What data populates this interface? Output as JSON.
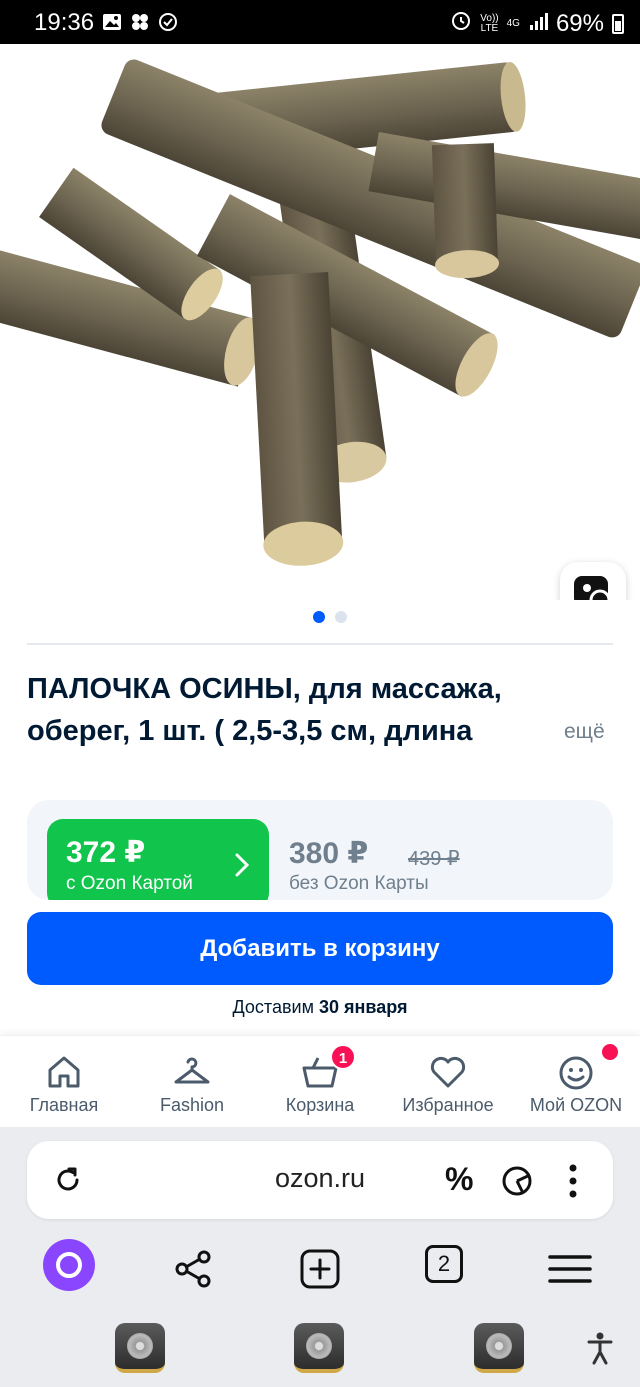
{
  "status_bar": {
    "time": "19:36",
    "network_top": "Vo))",
    "network_bottom": "LTE",
    "signal_type": "4G",
    "battery": "69%"
  },
  "product": {
    "image_alt": "Aspen wood sticks",
    "carousel": {
      "total": 2,
      "active": 1
    },
    "title_line1": "ПАЛОЧКА ОСИНЫ, для массажа,",
    "title_line2": "оберег, 1 шт. ( 2,5-3,5 см, длина",
    "more_label": "ещё"
  },
  "pricing": {
    "card_price": "372 ₽",
    "card_label": "с Ozon Картой",
    "regular_price": "380 ₽",
    "old_price": "439 ₽",
    "regular_label": "без Ozon Карты"
  },
  "actions": {
    "add_to_cart": "Добавить в корзину",
    "delivery_prefix": "Доставим",
    "delivery_date": "30 января"
  },
  "bottom_nav": {
    "items": [
      {
        "label": "Главная",
        "icon": "home-icon"
      },
      {
        "label": "Fashion",
        "icon": "hanger-icon"
      },
      {
        "label": "Корзина",
        "icon": "cart-icon",
        "badge": "1"
      },
      {
        "label": "Избранное",
        "icon": "heart-icon"
      },
      {
        "label": "Мой OZON",
        "icon": "smile-icon"
      }
    ]
  },
  "browser": {
    "url": "ozon.ru",
    "percent_symbol": "%",
    "tabs_count": "2"
  },
  "colors": {
    "accent_blue": "#005bff",
    "ozon_card_green": "#10c44c",
    "badge_red": "#f91155",
    "alice_purple": "#8a46ff"
  }
}
